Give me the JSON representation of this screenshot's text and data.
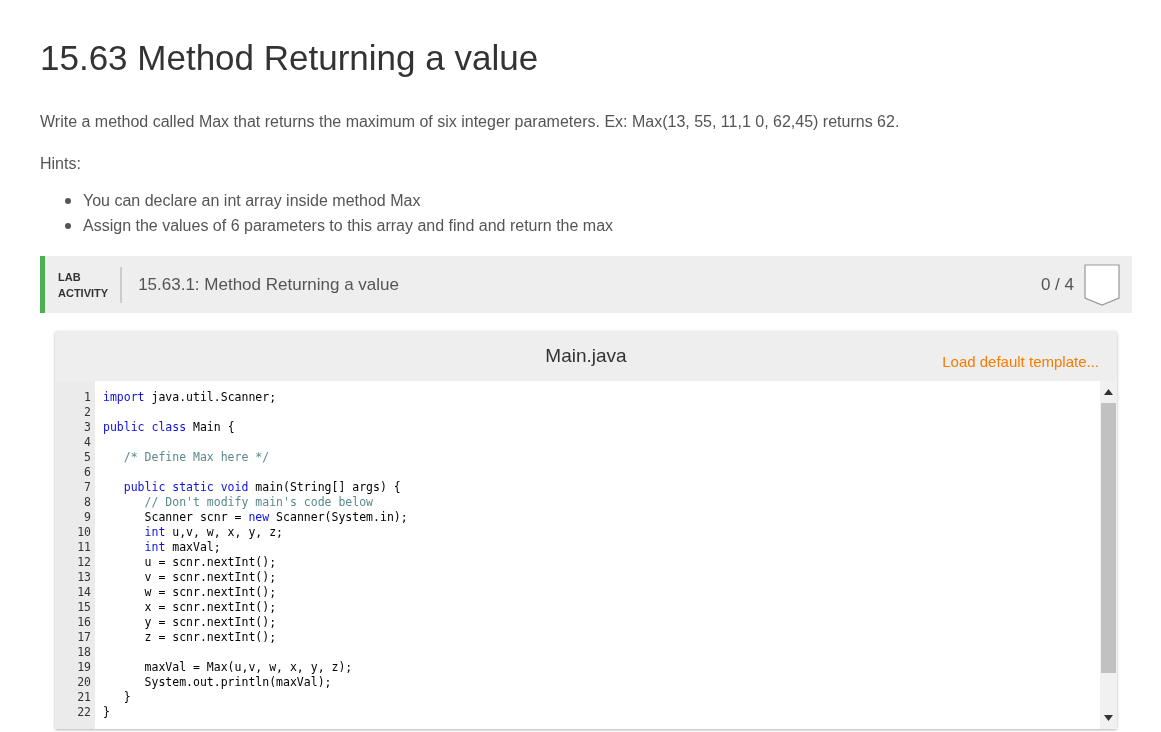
{
  "title": "15.63 Method Returning a value",
  "description": "Write a method called Max that returns the maximum of six integer parameters. Ex: Max(13, 55, 11,1 0, 62,45) returns 62.",
  "hints_label": "Hints:",
  "hints": [
    "You can declare an int array inside method Max",
    "Assign the values of 6 parameters to this array and find and return the max"
  ],
  "lab": {
    "badge_line_1": "LAB",
    "badge_line_2": "ACTIVITY",
    "name": "15.63.1: Method Returning a value",
    "score": "0 / 4"
  },
  "editor": {
    "file_name": "Main.java",
    "load_template": "Load default template...",
    "lines": [
      {
        "number": "1",
        "tokens": [
          {
            "kind": "keyword",
            "text": "import"
          },
          {
            "kind": "plain",
            "text": " java.util.Scanner;"
          }
        ]
      },
      {
        "number": "2"
      },
      {
        "number": "3",
        "tokens": [
          {
            "kind": "keyword",
            "text": "public class"
          },
          {
            "kind": "plain",
            "text": " Main {"
          }
        ]
      },
      {
        "number": "4"
      },
      {
        "number": "5",
        "tokens": [
          {
            "kind": "comment",
            "text": "   /* Define Max here */"
          }
        ]
      },
      {
        "number": "6"
      },
      {
        "number": "7",
        "tokens": [
          {
            "kind": "keyword",
            "text": "   public static void"
          },
          {
            "kind": "plain",
            "text": " main(String[] args) {"
          }
        ]
      },
      {
        "number": "8",
        "tokens": [
          {
            "kind": "comment",
            "text": "      // Don't modify main's code below"
          }
        ]
      },
      {
        "number": "9",
        "tokens": [
          {
            "kind": "plain",
            "text": "      Scanner scnr = "
          },
          {
            "kind": "keyword",
            "text": "new"
          },
          {
            "kind": "plain",
            "text": " Scanner(System.in);"
          }
        ]
      },
      {
        "number": "10",
        "tokens": [
          {
            "kind": "keyword",
            "text": "      int"
          },
          {
            "kind": "plain",
            "text": " u,v, w, x, y, z;"
          }
        ]
      },
      {
        "number": "11",
        "tokens": [
          {
            "kind": "keyword",
            "text": "      int"
          },
          {
            "kind": "plain",
            "text": " maxVal;"
          }
        ]
      },
      {
        "number": "12",
        "tokens": [
          {
            "kind": "plain",
            "text": "      u = scnr.nextInt();"
          }
        ]
      },
      {
        "number": "13",
        "tokens": [
          {
            "kind": "plain",
            "text": "      v = scnr.nextInt();"
          }
        ]
      },
      {
        "number": "14",
        "tokens": [
          {
            "kind": "plain",
            "text": "      w = scnr.nextInt();"
          }
        ]
      },
      {
        "number": "15",
        "tokens": [
          {
            "kind": "plain",
            "text": "      x = scnr.nextInt();"
          }
        ]
      },
      {
        "number": "16",
        "tokens": [
          {
            "kind": "plain",
            "text": "      y = scnr.nextInt();"
          }
        ]
      },
      {
        "number": "17",
        "tokens": [
          {
            "kind": "plain",
            "text": "      z = scnr.nextInt();"
          }
        ]
      },
      {
        "number": "18"
      },
      {
        "number": "19",
        "tokens": [
          {
            "kind": "plain",
            "text": "      maxVal = Max(u,v, w, x, y, z);"
          }
        ]
      },
      {
        "number": "20",
        "tokens": [
          {
            "kind": "plain",
            "text": "      System.out.println(maxVal);"
          }
        ]
      },
      {
        "number": "21",
        "tokens": [
          {
            "kind": "plain",
            "text": "   }"
          }
        ]
      },
      {
        "number": "22",
        "tokens": [
          {
            "kind": "plain",
            "text": "}"
          }
        ]
      }
    ]
  }
}
